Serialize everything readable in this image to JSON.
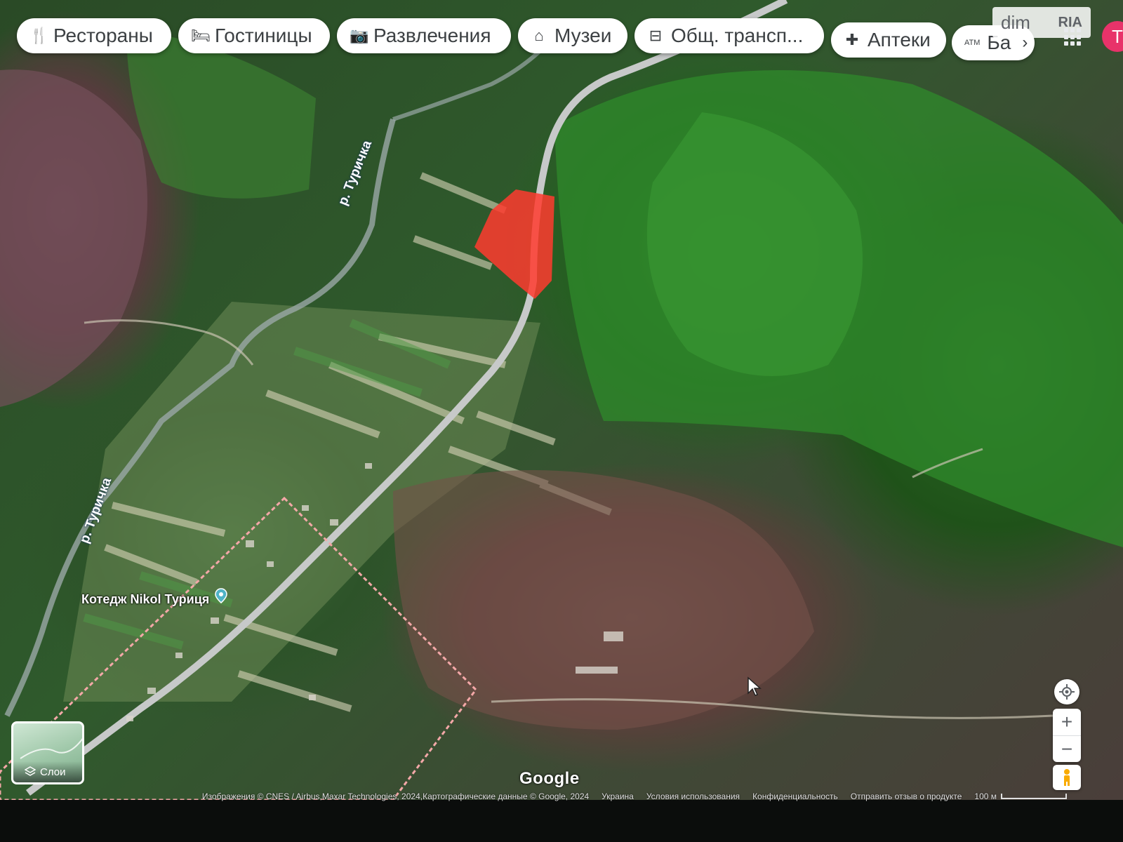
{
  "top_chips": [
    {
      "label": "Рестораны",
      "icon": "restaurant-icon"
    },
    {
      "label": "Гостиницы",
      "icon": "hotel-icon"
    },
    {
      "label": "Развлечения",
      "icon": "camera-icon"
    },
    {
      "label": "Музеи",
      "icon": "museum-icon"
    },
    {
      "label": "Общ. трансп...",
      "icon": "transit-icon"
    },
    {
      "label": "Аптеки",
      "icon": "pharmacy-icon"
    },
    {
      "label": "Ба",
      "icon": "atm-icon"
    }
  ],
  "watermark": {
    "text": "dim",
    "brand": "RIA"
  },
  "account": {
    "initial": "Т"
  },
  "map_labels": {
    "river_upper": "р. Туричка",
    "river_lower": "р. Туричка",
    "place": "Котедж Nikol Туриця"
  },
  "layers_button": {
    "label": "Слои"
  },
  "google_logo": "Google",
  "footer": {
    "attribution": "Изображения © CNES / Airbus,Maxar Technologies, 2024,Картографические данные © Google, 2024",
    "country": "Украина",
    "terms": "Условия использования",
    "privacy": "Конфиденциальность",
    "feedback": "Отправить отзыв о продукте",
    "scale": "100 м"
  },
  "colors": {
    "highlight_red": "#ff3b2f",
    "boundary_dashed": "#f4a8a8",
    "avatar": "#e8336a"
  }
}
